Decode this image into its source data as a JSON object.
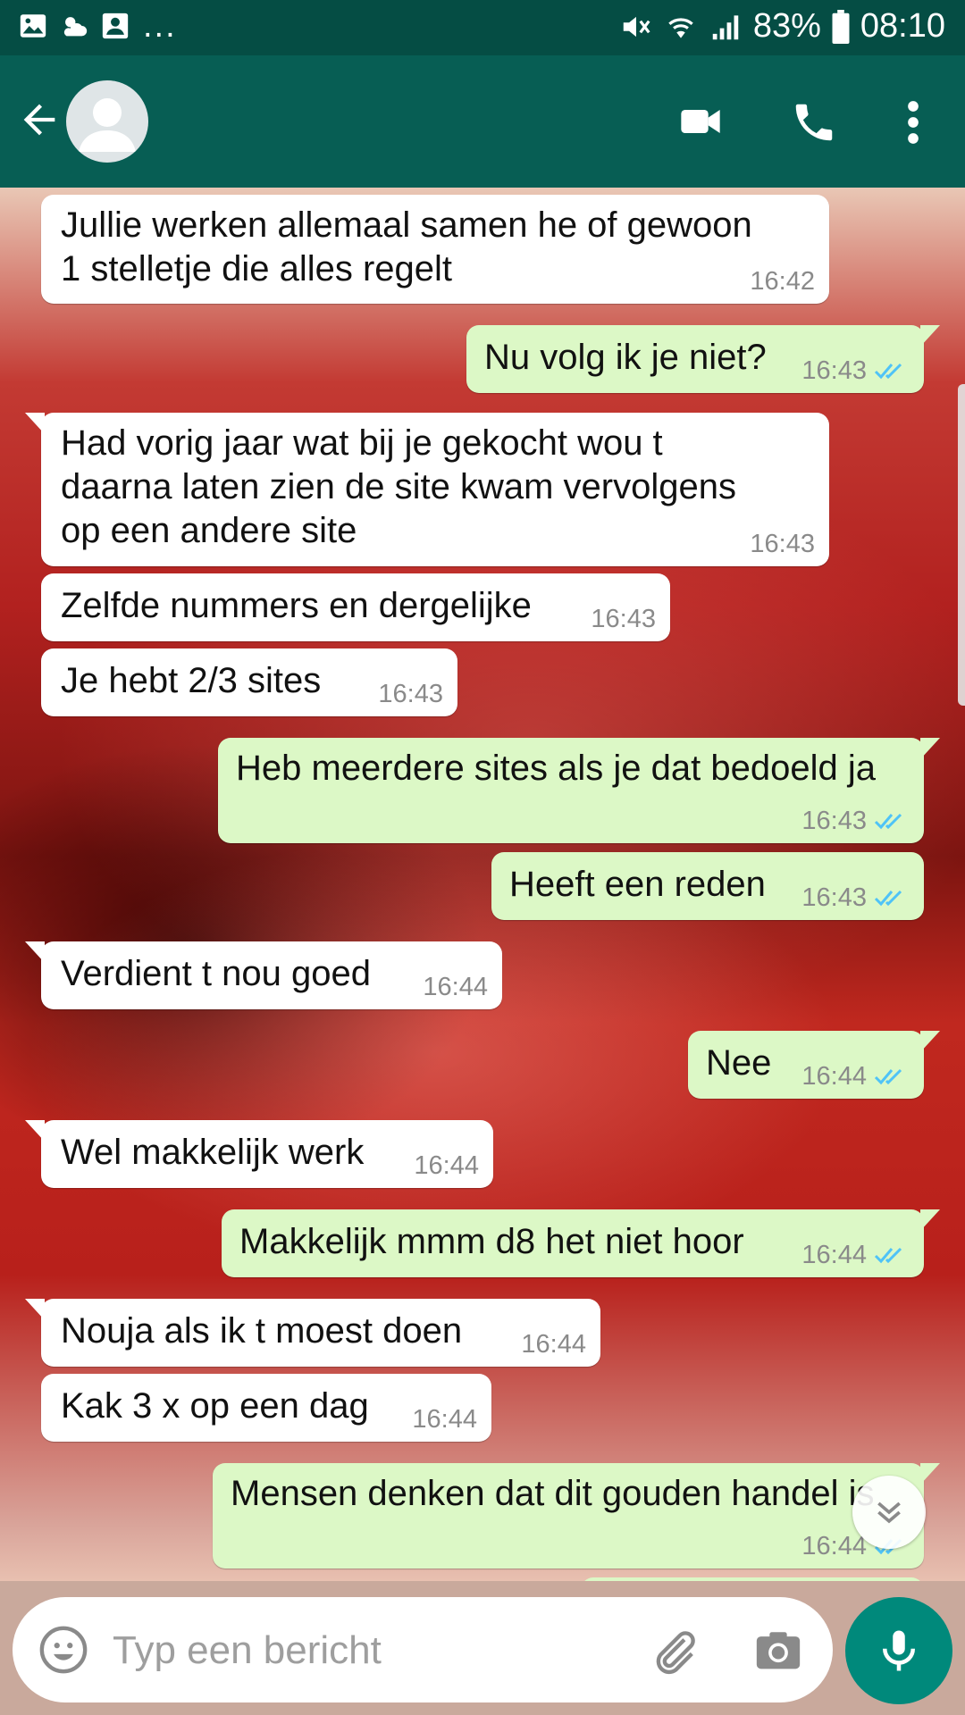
{
  "status_bar": {
    "left_icons": [
      "gallery-icon",
      "weather-icon",
      "contact-card-icon"
    ],
    "overflow": "...",
    "battery": "83%",
    "time": "08:10"
  },
  "app_bar": {
    "icons": [
      "back-arrow-icon",
      "avatar",
      "video-call-icon",
      "phone-call-icon",
      "more-options-icon"
    ]
  },
  "messages": [
    {
      "dir": "in",
      "text": "Jullie werken allemaal samen he of gewoon\n1 stelletje die alles regelt",
      "time": "16:42"
    },
    {
      "dir": "out",
      "text": "Nu volg ik je niet?",
      "time": "16:43"
    },
    {
      "dir": "in",
      "text": "Had vorig jaar wat bij je gekocht wou t\ndaarna laten zien de site kwam vervolgens\nop een andere site",
      "time": "16:43"
    },
    {
      "dir": "in",
      "text": "Zelfde nummers en dergelijke",
      "time": "16:43"
    },
    {
      "dir": "in",
      "text": "Je hebt 2/3 sites",
      "time": "16:43"
    },
    {
      "dir": "out",
      "text": "Heb meerdere sites als je dat bedoeld ja",
      "time": "16:43"
    },
    {
      "dir": "out",
      "text": "Heeft een reden",
      "time": "16:43"
    },
    {
      "dir": "in",
      "text": "Verdient t nou goed",
      "time": "16:44"
    },
    {
      "dir": "out",
      "text": "Nee",
      "time": "16:44"
    },
    {
      "dir": "in",
      "text": "Wel makkelijk werk",
      "time": "16:44"
    },
    {
      "dir": "out",
      "text": "Makkelijk mmm d8 het niet hoor",
      "time": "16:44"
    },
    {
      "dir": "in",
      "text": "Nouja als ik t moest doen",
      "time": "16:44"
    },
    {
      "dir": "in",
      "text": "Kak 3 x op een dag",
      "time": "16:44"
    },
    {
      "dir": "out",
      "text": "Mensen denken dat dit gouden handel is",
      "time": "16:44"
    }
  ],
  "input": {
    "placeholder": "Typ een bericht"
  },
  "colors": {
    "status_bar": "#054d44",
    "app_bar": "#075e54",
    "outgoing_bubble": "#dcf8c6",
    "incoming_bubble": "#ffffff",
    "read_ticks": "#4fc3f7",
    "mic_button": "#00897b"
  }
}
